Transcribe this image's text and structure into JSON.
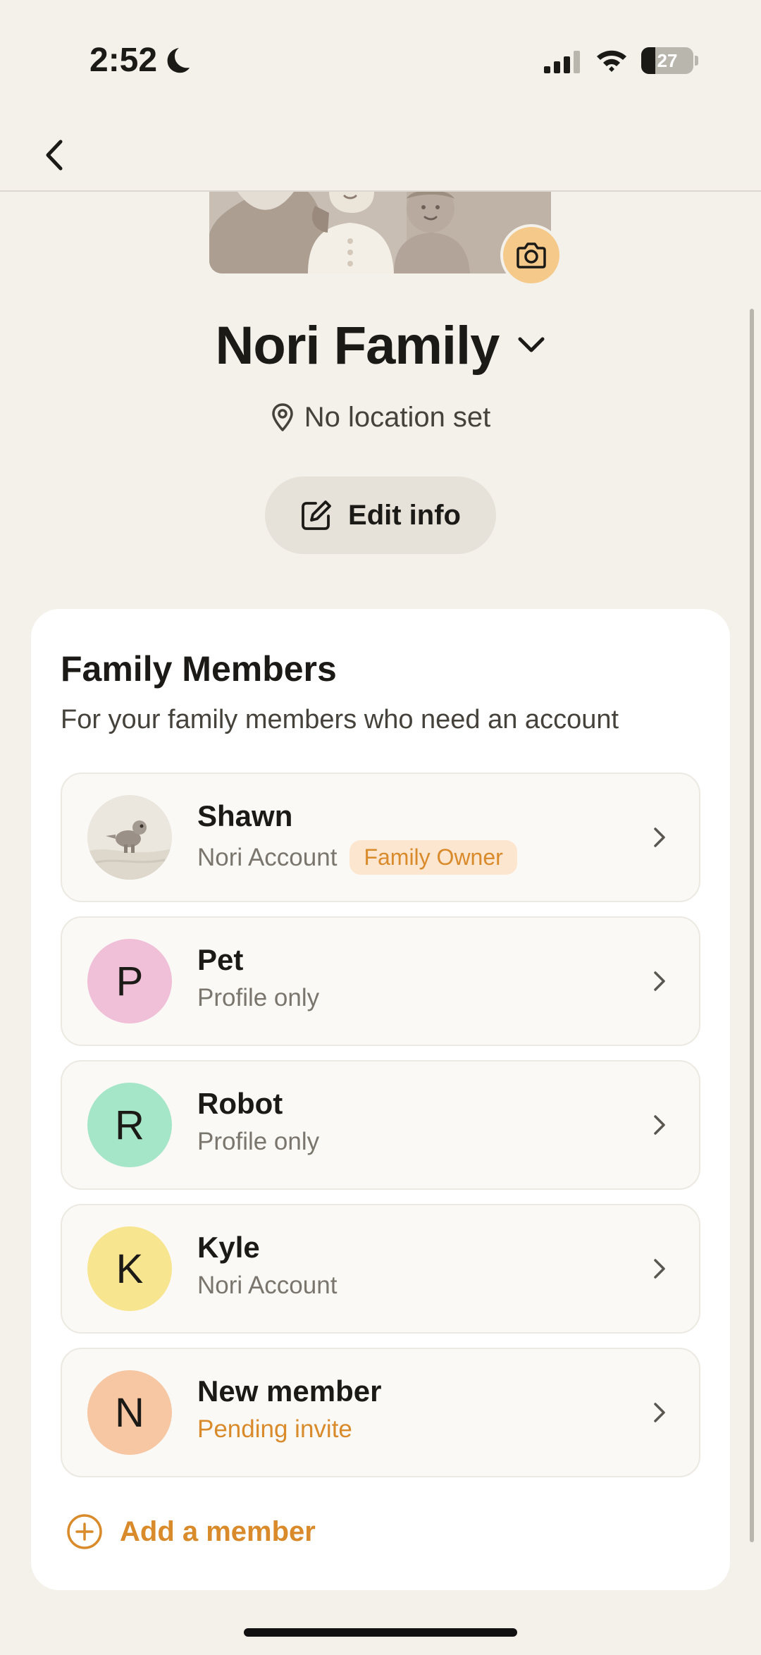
{
  "status_bar": {
    "time": "2:52",
    "battery": "27"
  },
  "family": {
    "name": "Nori Family",
    "location": "No location set",
    "edit_label": "Edit info"
  },
  "members_card": {
    "title": "Family Members",
    "subtitle": "For your family members who need an account",
    "members": [
      {
        "initial": "",
        "name": "Shawn",
        "type": "Nori Account",
        "badge": "Family Owner",
        "avatar_color": "#e9e5dc"
      },
      {
        "initial": "P",
        "name": "Pet",
        "type": "Profile only",
        "avatar_color": "#f0c0d8"
      },
      {
        "initial": "R",
        "name": "Robot",
        "type": "Profile only",
        "avatar_color": "#a6e6c8"
      },
      {
        "initial": "K",
        "name": "Kyle",
        "type": "Nori Account",
        "avatar_color": "#f8e590"
      },
      {
        "initial": "N",
        "name": "New member",
        "type": "Pending invite",
        "avatar_color": "#f7c6a2"
      }
    ],
    "add_label": "Add a member"
  },
  "icons": {
    "back": "chevron-left-icon",
    "camera": "camera-icon",
    "dropdown": "chevron-down-icon",
    "location": "map-pin-icon",
    "edit": "edit-icon",
    "row_chevron": "chevron-right-icon",
    "add": "plus-circle-icon"
  },
  "colors": {
    "background": "#f3f1ea",
    "accent": "#d98a2a",
    "card": "#ffffff"
  }
}
